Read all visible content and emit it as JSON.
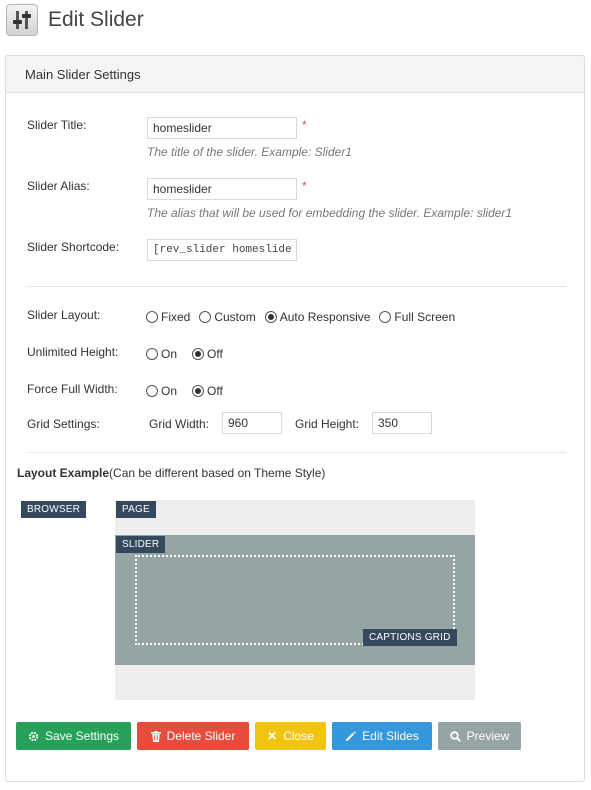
{
  "header": {
    "title": "Edit Slider",
    "icon": "sliders-icon"
  },
  "panel": {
    "title": "Main Slider Settings"
  },
  "fields": {
    "title": {
      "label": "Slider Title:",
      "value": "homeslider",
      "required": "*",
      "description": "The title of the slider. Example: Slider1"
    },
    "alias": {
      "label": "Slider Alias:",
      "value": "homeslider",
      "required": "*",
      "description": "The alias that will be used for embedding the slider. Example: slider1"
    },
    "shortcode": {
      "label": "Slider Shortcode:",
      "value": "[rev_slider homeslider]"
    }
  },
  "layout": {
    "label": "Slider Layout:",
    "options": [
      "Fixed",
      "Custom",
      "Auto Responsive",
      "Full Screen"
    ],
    "selected": "Auto Responsive"
  },
  "unlimited_height": {
    "label": "Unlimited Height:",
    "options": [
      "On",
      "Off"
    ],
    "selected": "Off"
  },
  "force_full_width": {
    "label": "Force Full Width:",
    "options": [
      "On",
      "Off"
    ],
    "selected": "Off"
  },
  "grid": {
    "label": "Grid Settings:",
    "width_label": "Grid Width:",
    "width_value": "960",
    "height_label": "Grid Height:",
    "height_value": "350"
  },
  "layout_example": {
    "title_bold": "Layout Example",
    "title_note": "(Can be different based on Theme Style)",
    "tags": {
      "browser": "BROWSER",
      "page": "PAGE",
      "slider": "SLIDER",
      "captions": "CAPTIONS GRID"
    }
  },
  "buttons": {
    "save": "Save Settings",
    "delete": "Delete Slider",
    "close": "Close",
    "edit": "Edit Slides",
    "preview": "Preview"
  },
  "colors": {
    "save": "#27a05a",
    "delete": "#e74c3c",
    "close": "#f1c40f",
    "edit": "#3498db",
    "preview": "#95a5a6",
    "tag": "#34495e",
    "slider_area": "#95a5a6"
  }
}
